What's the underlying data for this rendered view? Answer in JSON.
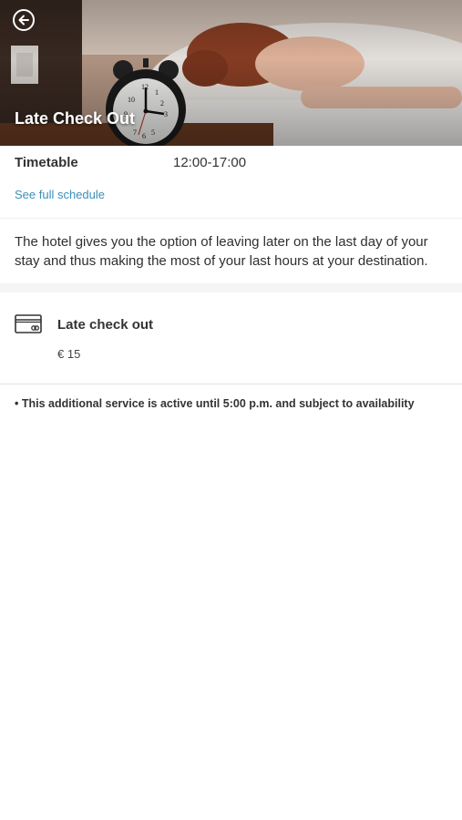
{
  "hero": {
    "title": "Late Check Out",
    "back_icon": "arrow-left-circle-icon"
  },
  "timetable": {
    "label": "Timetable",
    "value": "12:00-17:00",
    "link": "See full schedule"
  },
  "description": "The hotel gives you the option of leaving later on the last day of your stay and thus making the most of your last hours at your destination.",
  "service": {
    "icon": "credit-card-icon",
    "name": "Late check out",
    "price": "€ 15"
  },
  "note": "• This additional service is active until 5:00 p.m. and subject to availability",
  "colors": {
    "link": "#3a8fb7",
    "text": "#2f2f2f",
    "background": "#ffffff"
  }
}
